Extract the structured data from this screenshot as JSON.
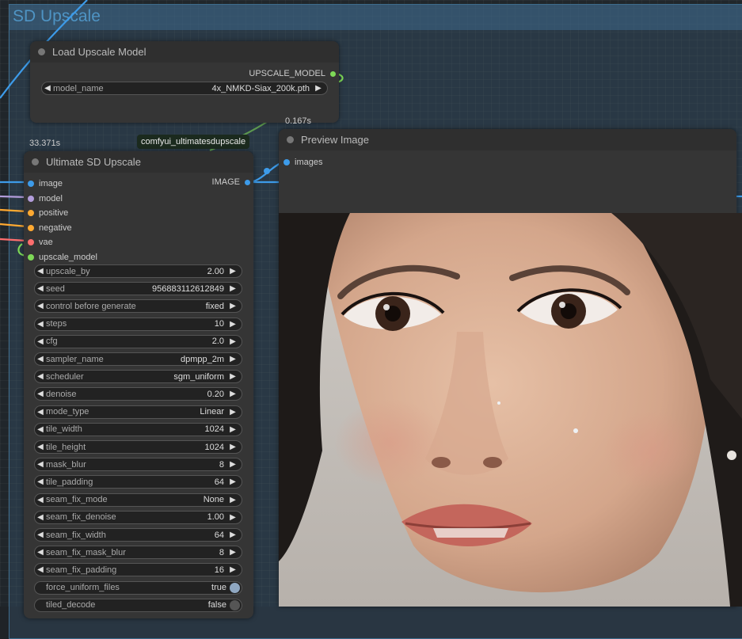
{
  "group": {
    "title": "SD Upscale"
  },
  "load_node": {
    "title": "Load Upscale Model",
    "output": "UPSCALE_MODEL",
    "widget": {
      "label": "model_name",
      "value": "4x_NMKD-Siax_200k.pth"
    },
    "time": "0.167s"
  },
  "usd_node": {
    "title": "Ultimate SD Upscale",
    "time": "33.371s",
    "tag": "comfyui_ultimatesdupscale",
    "output": "IMAGE",
    "inputs": [
      {
        "label": "image",
        "color": "#3d9be9"
      },
      {
        "label": "model",
        "color": "#b39ddb"
      },
      {
        "label": "positive",
        "color": "#ffa931"
      },
      {
        "label": "negative",
        "color": "#ffa931"
      },
      {
        "label": "vae",
        "color": "#ff6e6e"
      },
      {
        "label": "upscale_model",
        "color": "#7ed957"
      }
    ],
    "widgets": [
      {
        "label": "upscale_by",
        "value": "2.00"
      },
      {
        "label": "seed",
        "value": "956883112612849"
      },
      {
        "label": "control before generate",
        "value": "fixed"
      },
      {
        "label": "steps",
        "value": "10"
      },
      {
        "label": "cfg",
        "value": "2.0"
      },
      {
        "label": "sampler_name",
        "value": "dpmpp_2m"
      },
      {
        "label": "scheduler",
        "value": "sgm_uniform"
      },
      {
        "label": "denoise",
        "value": "0.20"
      },
      {
        "label": "mode_type",
        "value": "Linear"
      },
      {
        "label": "tile_width",
        "value": "1024"
      },
      {
        "label": "tile_height",
        "value": "1024"
      },
      {
        "label": "mask_blur",
        "value": "8"
      },
      {
        "label": "tile_padding",
        "value": "64"
      },
      {
        "label": "seam_fix_mode",
        "value": "None"
      },
      {
        "label": "seam_fix_denoise",
        "value": "1.00"
      },
      {
        "label": "seam_fix_width",
        "value": "64"
      },
      {
        "label": "seam_fix_mask_blur",
        "value": "8"
      },
      {
        "label": "seam_fix_padding",
        "value": "16"
      }
    ],
    "toggles": [
      {
        "label": "force_uniform_files",
        "value": "true"
      },
      {
        "label": "tiled_decode",
        "value": "false"
      }
    ]
  },
  "preview_node": {
    "title": "Preview Image",
    "input": "images"
  },
  "colors": {
    "link_blue": "#3d9be9",
    "link_green": "#7ed957",
    "link_orange": "#ffa931",
    "link_purple": "#b39ddb",
    "link_red": "#ff6e6e"
  }
}
